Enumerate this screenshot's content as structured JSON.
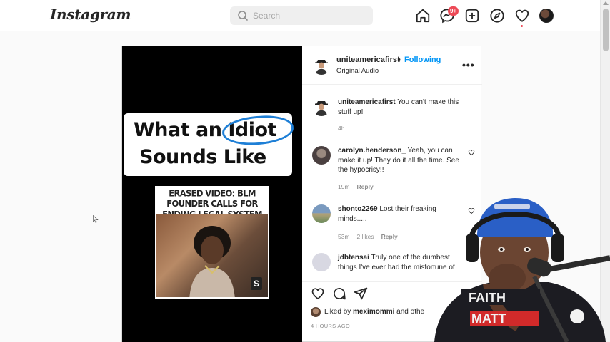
{
  "app": {
    "logo": "Instagram"
  },
  "search": {
    "placeholder": "Search"
  },
  "nav": {
    "icons": [
      "home-icon",
      "messenger-icon",
      "new-post-icon",
      "explore-icon",
      "activity-icon",
      "profile-avatar"
    ],
    "messages_badge": "9+"
  },
  "post": {
    "author": "uniteamericafirst",
    "separator": "•",
    "follow_status": "Following",
    "audio": "Original Audio",
    "more": "•••",
    "media": {
      "title_line1": "What an Idiot",
      "title_line2": "Sounds Like",
      "news_headline": "ERASED VIDEO: BLM FOUNDER CALLS FOR ENDING LEGAL SYSTEM",
      "watermark": "S"
    },
    "comments": [
      {
        "user": "uniteamericafirst",
        "text": "You can't make this stuff up!",
        "time": "4h",
        "likes": "",
        "reply": ""
      },
      {
        "user": "carolyn.henderson_",
        "text": "Yeah, you can make it up! They do it all the time. See the hypocrisy!!",
        "time": "19m",
        "likes": "",
        "reply": "Reply"
      },
      {
        "user": "shonto2269",
        "text": "Lost their freaking minds.....",
        "time": "53m",
        "likes": "2 likes",
        "reply": "Reply"
      },
      {
        "user": "jdbtensai",
        "text": "Truly one of the dumbest things I've ever had the misfortune of",
        "time": "",
        "likes": "",
        "reply": ""
      }
    ],
    "liked_by_prefix": "Liked by",
    "liked_by_user": "meximommi",
    "liked_by_suffix": "and othe",
    "time_ago": "4 HOURS AGO"
  },
  "webcam": {
    "shirt_text_top": "FAITH",
    "shirt_text_bottom": "MATT"
  },
  "colors": {
    "accent": "#0095f6",
    "badge": "#ed4956",
    "circle": "#1e7fd6"
  }
}
